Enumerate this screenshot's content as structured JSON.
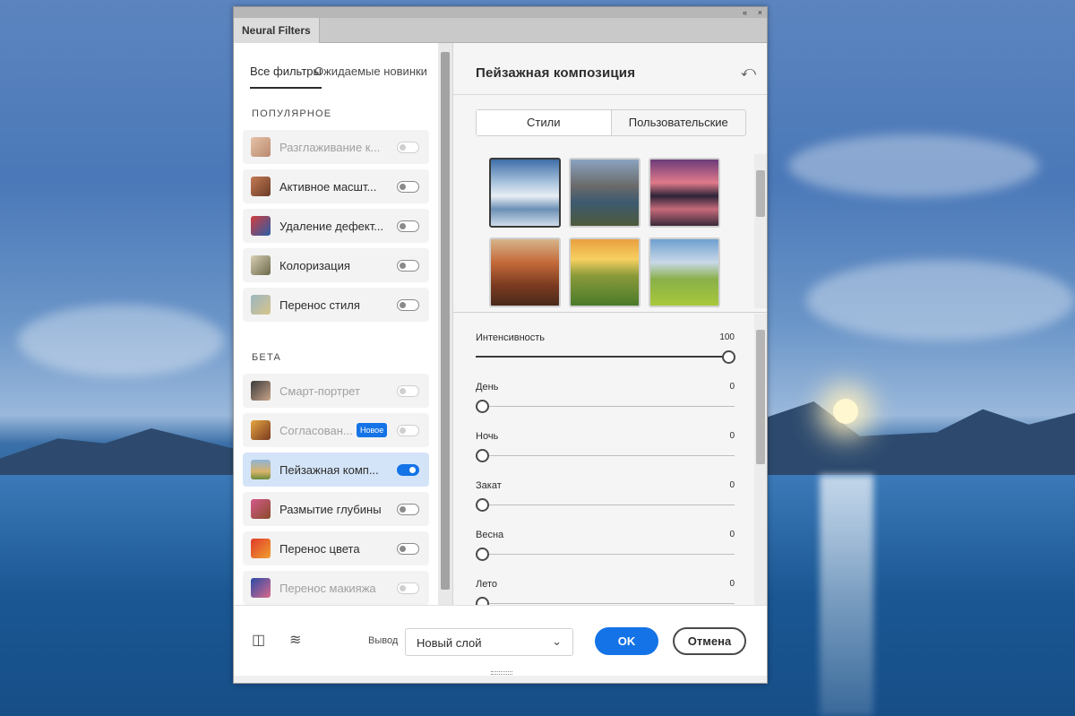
{
  "window": {
    "title": "Neural Filters",
    "controls": [
      "«",
      "×"
    ]
  },
  "left_tabs": {
    "all": "Все фильтры",
    "upcoming": "Ожидаемые новинки"
  },
  "sections": {
    "popular": "ПОПУЛЯРНОЕ",
    "beta": "БЕТА"
  },
  "popular_items": [
    {
      "label": "Разглаживание к...",
      "enabled": false,
      "disabled": true
    },
    {
      "label": "Активное масшт...",
      "enabled": false,
      "disabled": false
    },
    {
      "label": "Удаление дефект...",
      "enabled": false,
      "disabled": false
    },
    {
      "label": "Колоризация",
      "enabled": false,
      "disabled": false
    },
    {
      "label": "Перенос стиля",
      "enabled": false,
      "disabled": false
    }
  ],
  "beta_items": [
    {
      "label": "Смарт-портрет",
      "enabled": false,
      "disabled": true
    },
    {
      "label": "Согласован...",
      "enabled": false,
      "disabled": true,
      "badge": "Новое"
    },
    {
      "label": "Пейзажная комп...",
      "enabled": true,
      "disabled": false,
      "selected": true
    },
    {
      "label": "Размытие глубины",
      "enabled": false,
      "disabled": false
    },
    {
      "label": "Перенос цвета",
      "enabled": false,
      "disabled": false
    },
    {
      "label": "Перенос макияжа",
      "enabled": false,
      "disabled": true
    }
  ],
  "panel": {
    "title": "Пейзажная композиция",
    "segments": {
      "styles": "Стили",
      "custom": "Пользовательские"
    },
    "thumbnails": [
      "snowy-lake-mountain",
      "mountain-valley-lake",
      "sunset-peak-reflection",
      "canyon",
      "sunrise-hills",
      "green-meadow-peaks"
    ],
    "selected_thumbnail": 0
  },
  "sliders": [
    {
      "name": "Интенсивность",
      "value": "100",
      "fraction": 1.0
    },
    {
      "name": "День",
      "value": "0",
      "fraction": 0
    },
    {
      "name": "Ночь",
      "value": "0",
      "fraction": 0
    },
    {
      "name": "Закат",
      "value": "0",
      "fraction": 0
    },
    {
      "name": "Весна",
      "value": "0",
      "fraction": 0
    },
    {
      "name": "Лето",
      "value": "0",
      "fraction": 0
    }
  ],
  "footer": {
    "output_label": "Вывод",
    "output_value": "Новый слой",
    "ok": "OK",
    "cancel": "Отмена"
  },
  "colors": {
    "accent": "#1473e6",
    "selected_item": "#d4e4f8"
  }
}
